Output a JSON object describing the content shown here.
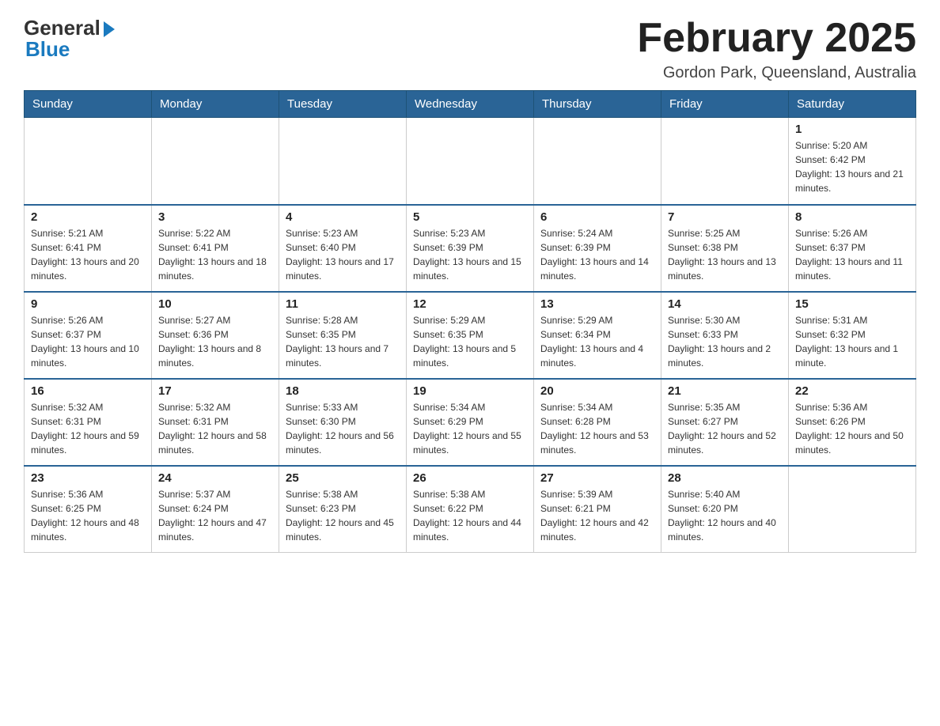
{
  "header": {
    "logo_general": "General",
    "logo_blue": "Blue",
    "month_title": "February 2025",
    "location": "Gordon Park, Queensland, Australia"
  },
  "days_of_week": [
    "Sunday",
    "Monday",
    "Tuesday",
    "Wednesday",
    "Thursday",
    "Friday",
    "Saturday"
  ],
  "weeks": [
    [
      {
        "day": "",
        "info": ""
      },
      {
        "day": "",
        "info": ""
      },
      {
        "day": "",
        "info": ""
      },
      {
        "day": "",
        "info": ""
      },
      {
        "day": "",
        "info": ""
      },
      {
        "day": "",
        "info": ""
      },
      {
        "day": "1",
        "info": "Sunrise: 5:20 AM\nSunset: 6:42 PM\nDaylight: 13 hours and 21 minutes."
      }
    ],
    [
      {
        "day": "2",
        "info": "Sunrise: 5:21 AM\nSunset: 6:41 PM\nDaylight: 13 hours and 20 minutes."
      },
      {
        "day": "3",
        "info": "Sunrise: 5:22 AM\nSunset: 6:41 PM\nDaylight: 13 hours and 18 minutes."
      },
      {
        "day": "4",
        "info": "Sunrise: 5:23 AM\nSunset: 6:40 PM\nDaylight: 13 hours and 17 minutes."
      },
      {
        "day": "5",
        "info": "Sunrise: 5:23 AM\nSunset: 6:39 PM\nDaylight: 13 hours and 15 minutes."
      },
      {
        "day": "6",
        "info": "Sunrise: 5:24 AM\nSunset: 6:39 PM\nDaylight: 13 hours and 14 minutes."
      },
      {
        "day": "7",
        "info": "Sunrise: 5:25 AM\nSunset: 6:38 PM\nDaylight: 13 hours and 13 minutes."
      },
      {
        "day": "8",
        "info": "Sunrise: 5:26 AM\nSunset: 6:37 PM\nDaylight: 13 hours and 11 minutes."
      }
    ],
    [
      {
        "day": "9",
        "info": "Sunrise: 5:26 AM\nSunset: 6:37 PM\nDaylight: 13 hours and 10 minutes."
      },
      {
        "day": "10",
        "info": "Sunrise: 5:27 AM\nSunset: 6:36 PM\nDaylight: 13 hours and 8 minutes."
      },
      {
        "day": "11",
        "info": "Sunrise: 5:28 AM\nSunset: 6:35 PM\nDaylight: 13 hours and 7 minutes."
      },
      {
        "day": "12",
        "info": "Sunrise: 5:29 AM\nSunset: 6:35 PM\nDaylight: 13 hours and 5 minutes."
      },
      {
        "day": "13",
        "info": "Sunrise: 5:29 AM\nSunset: 6:34 PM\nDaylight: 13 hours and 4 minutes."
      },
      {
        "day": "14",
        "info": "Sunrise: 5:30 AM\nSunset: 6:33 PM\nDaylight: 13 hours and 2 minutes."
      },
      {
        "day": "15",
        "info": "Sunrise: 5:31 AM\nSunset: 6:32 PM\nDaylight: 13 hours and 1 minute."
      }
    ],
    [
      {
        "day": "16",
        "info": "Sunrise: 5:32 AM\nSunset: 6:31 PM\nDaylight: 12 hours and 59 minutes."
      },
      {
        "day": "17",
        "info": "Sunrise: 5:32 AM\nSunset: 6:31 PM\nDaylight: 12 hours and 58 minutes."
      },
      {
        "day": "18",
        "info": "Sunrise: 5:33 AM\nSunset: 6:30 PM\nDaylight: 12 hours and 56 minutes."
      },
      {
        "day": "19",
        "info": "Sunrise: 5:34 AM\nSunset: 6:29 PM\nDaylight: 12 hours and 55 minutes."
      },
      {
        "day": "20",
        "info": "Sunrise: 5:34 AM\nSunset: 6:28 PM\nDaylight: 12 hours and 53 minutes."
      },
      {
        "day": "21",
        "info": "Sunrise: 5:35 AM\nSunset: 6:27 PM\nDaylight: 12 hours and 52 minutes."
      },
      {
        "day": "22",
        "info": "Sunrise: 5:36 AM\nSunset: 6:26 PM\nDaylight: 12 hours and 50 minutes."
      }
    ],
    [
      {
        "day": "23",
        "info": "Sunrise: 5:36 AM\nSunset: 6:25 PM\nDaylight: 12 hours and 48 minutes."
      },
      {
        "day": "24",
        "info": "Sunrise: 5:37 AM\nSunset: 6:24 PM\nDaylight: 12 hours and 47 minutes."
      },
      {
        "day": "25",
        "info": "Sunrise: 5:38 AM\nSunset: 6:23 PM\nDaylight: 12 hours and 45 minutes."
      },
      {
        "day": "26",
        "info": "Sunrise: 5:38 AM\nSunset: 6:22 PM\nDaylight: 12 hours and 44 minutes."
      },
      {
        "day": "27",
        "info": "Sunrise: 5:39 AM\nSunset: 6:21 PM\nDaylight: 12 hours and 42 minutes."
      },
      {
        "day": "28",
        "info": "Sunrise: 5:40 AM\nSunset: 6:20 PM\nDaylight: 12 hours and 40 minutes."
      },
      {
        "day": "",
        "info": ""
      }
    ]
  ]
}
